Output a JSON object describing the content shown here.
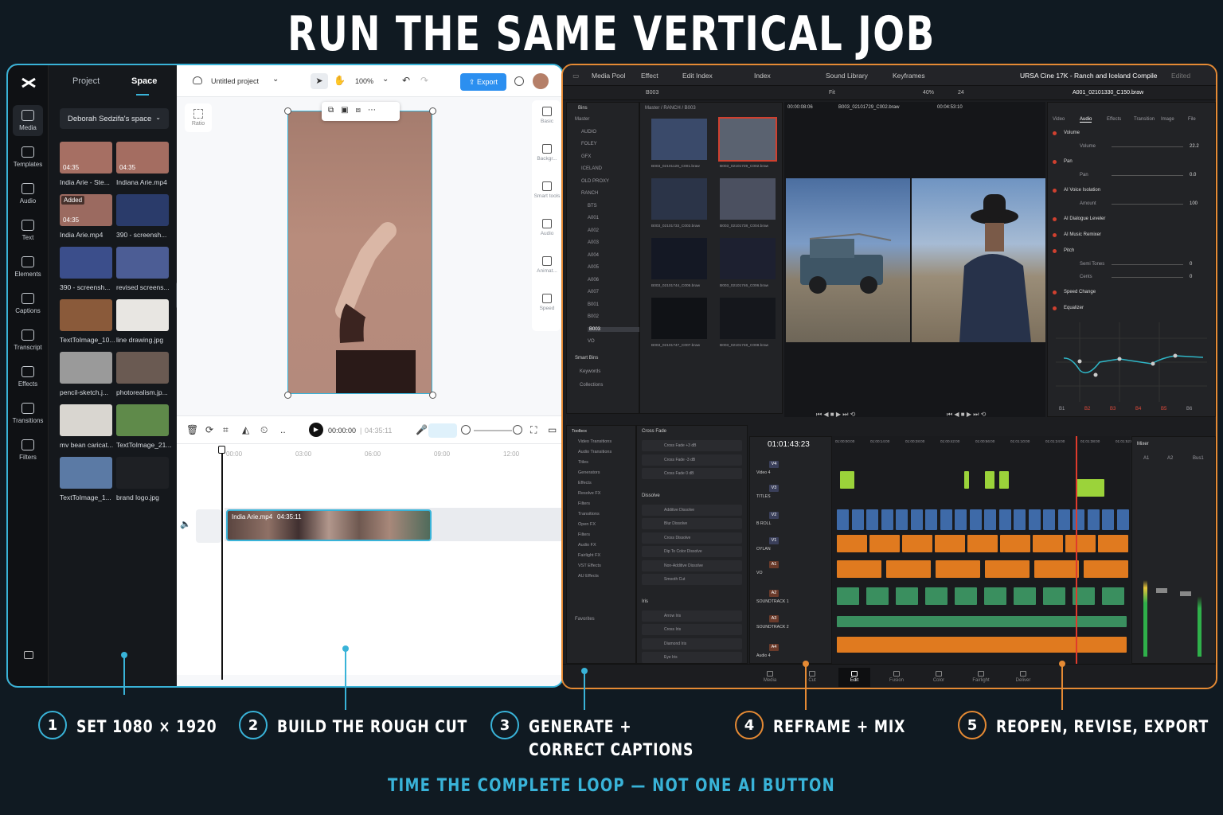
{
  "headline": "RUN THE SAME VERTICAL JOB",
  "capcut": {
    "rail": [
      "Media",
      "Templates",
      "Audio",
      "Text",
      "Elements",
      "Captions",
      "Transcript",
      "Effects",
      "Transitions",
      "Filters"
    ],
    "tabs": [
      "Project",
      "Space"
    ],
    "space": "Deborah Sedzifa's space",
    "media": [
      {
        "name": "India Arie - Ste...",
        "dur": "04:35",
        "color": "#a66f63"
      },
      {
        "name": "Indiana Arie.mp4",
        "dur": "04:35",
        "color": "#a46d61"
      },
      {
        "name": "India Arie.mp4",
        "dur": "04:35",
        "badge": "Added",
        "color": "#9b6a60"
      },
      {
        "name": "390 - screensh...",
        "color": "#2a3b6a"
      },
      {
        "name": "390 - screensh...",
        "color": "#3b4e8b"
      },
      {
        "name": "revised screens...",
        "color": "#4c5d95"
      },
      {
        "name": "TextToImage_10...",
        "color": "#8a5a3a"
      },
      {
        "name": "line drawing.jpg",
        "color": "#e8e6e2"
      },
      {
        "name": "pencil-sketch.j...",
        "color": "#9a9a9a"
      },
      {
        "name": "photorealism.jp...",
        "color": "#6a5a52"
      },
      {
        "name": "mv bean caricat...",
        "color": "#d9d6d0"
      },
      {
        "name": "TextToImage_21...",
        "color": "#5f8a4a"
      },
      {
        "name": "TextToImage_1...",
        "color": "#5b7aa5"
      },
      {
        "name": "brand logo.jpg",
        "color": "#1e2024"
      }
    ],
    "project": "Untitled project",
    "zoom": "100%",
    "export": "Export",
    "right_tools": [
      "Basic",
      "Backgr...",
      "Smart tools",
      "Audio",
      "Animat...",
      "Speed"
    ],
    "ratio": "Ratio",
    "time": "00:00:00",
    "total": "04:35:11",
    "ruler": [
      "00:00",
      "03:00",
      "06:00",
      "09:00",
      "12:00"
    ],
    "clip": "India Arie.mp4",
    "clip_dur": "04:35:11"
  },
  "resolve": {
    "topbar": [
      "Media Pool",
      "Effect",
      "Edit Index",
      "Index",
      "Sound Library",
      "Keyframes"
    ],
    "title": "URSA Cine 17K - Ranch and Iceland Compile",
    "edited": "Edited",
    "bin": "B003",
    "zoom": "40%",
    "fps": "24",
    "fit": "Fit",
    "path": "Master / RANCH / B003",
    "tc1": "00:00:08:06",
    "clipname": "B003_02101729_C002.braw",
    "tc2": "00:04:53:10",
    "inspector_clip": "A001_02101330_C150.braw",
    "bins": [
      "Master",
      "AUDIO",
      "FOLEY",
      "GFX",
      "ICELAND",
      "OLD PROXY",
      "RANCH",
      "BTS",
      "A001",
      "A002",
      "A003",
      "A004",
      "A005",
      "A006",
      "A007",
      "B001",
      "B002",
      "B003",
      "VO"
    ],
    "smart": [
      "Smart Bins",
      "Keywords",
      "Collections"
    ],
    "pool": [
      "B003_02101128_C001.braw",
      "B003_02101729_C002.braw",
      "B003_02101733_C003.braw",
      "B003_02101738_C004.braw",
      "B003_02101744_C005.braw",
      "B003_02101746_C006.braw",
      "B003_02101747_C007.braw",
      "B003_02101748_C008.braw"
    ],
    "insp_tabs": [
      "Video",
      "Audio",
      "Effects",
      "Transition",
      "Image",
      "File"
    ],
    "insp": [
      {
        "h": "Volume",
        "k": "Volume",
        "v": "22.2"
      },
      {
        "h": "Pan",
        "k": "Pan",
        "v": "0.0"
      },
      {
        "h": "AI Voice Isolation",
        "k": "Amount",
        "v": "100"
      },
      {
        "h": "AI Dialogue Leveler"
      },
      {
        "h": "AI Music Remixer"
      },
      {
        "h": "Pitch",
        "k": "Semi Tones",
        "v": "0",
        "k2": "Cents",
        "v2": "0"
      },
      {
        "h": "Speed Change"
      },
      {
        "h": "Equalizer"
      }
    ],
    "eq_bands": [
      "B1",
      "B2",
      "B3",
      "B4",
      "B5",
      "B6"
    ],
    "toolbox": [
      "Toolbox",
      "Video Transitions",
      "Audio Transitions",
      "Titles",
      "Generators",
      "Effects",
      "Resolve FX",
      "Filters",
      "Transitions",
      "Open FX",
      "Filters",
      "Audio FX",
      "Fairlight FX",
      "VST Effects",
      "AU Effects"
    ],
    "favorites": "Favorites",
    "fx_groups": [
      {
        "h": "Cross Fade",
        "items": [
          "Cross Fade +3 dB",
          "Cross Fade -3 dB",
          "Cross Fade 0 dB"
        ]
      },
      {
        "h": "Dissolve",
        "items": [
          "Additive Dissolve",
          "Blur Dissolve",
          "Cross Dissolve",
          "Dip To Color Dissolve",
          "Non-Additive Dissolve",
          "Smooth Cut"
        ]
      },
      {
        "h": "Iris",
        "items": [
          "Arrow Iris",
          "Cross Iris",
          "Diamond Iris",
          "Eye Iris"
        ]
      }
    ],
    "tl_tc": "01:01:43:23",
    "tracks": [
      {
        "id": "V4",
        "name": "Video 4"
      },
      {
        "id": "V3",
        "name": "TITLES"
      },
      {
        "id": "V2",
        "name": "B ROLL"
      },
      {
        "id": "V1",
        "name": "OYLAN"
      },
      {
        "id": "A1",
        "name": "VO"
      },
      {
        "id": "A2",
        "name": "SOUNDTRACK 1"
      },
      {
        "id": "A3",
        "name": "SOUNDTRACK 2"
      },
      {
        "id": "A4",
        "name": "Audio 4"
      }
    ],
    "ruler": [
      "01:00:00:00",
      "01:00:14:00",
      "01:00:28:00",
      "01:00:42:00",
      "01:00:56:00",
      "01:01:10:00",
      "01:01:24:00",
      "01:01:38:00",
      "01:01:52:00"
    ],
    "mixer": "Mixer",
    "mixer_ch": [
      "A1",
      "A2",
      "Bus1"
    ],
    "pages": [
      "Media",
      "Cut",
      "Edit",
      "Fusion",
      "Color",
      "Fairlight",
      "Deliver"
    ]
  },
  "steps": [
    {
      "n": "1",
      "l1": "SET 1080 × 1920"
    },
    {
      "n": "2",
      "l1": "BUILD THE ROUGH CUT"
    },
    {
      "n": "3",
      "l1": "GENERATE +",
      "l2": "CORRECT CAPTIONS"
    },
    {
      "n": "4",
      "l1": "REFRAME + MIX"
    },
    {
      "n": "5",
      "l1": "REOPEN, REVISE, EXPORT"
    }
  ],
  "footer": "TIME THE COMPLETE LOOP — NOT ONE AI BUTTON",
  "colors": {
    "accent_blue": "#39b3d8",
    "accent_orange": "#e58a34",
    "resolve_orange": "#e07a1f",
    "resolve_green": "#3a8f5f",
    "resolve_blue": "#3e6aa8",
    "title_green": "#9bd33a"
  }
}
